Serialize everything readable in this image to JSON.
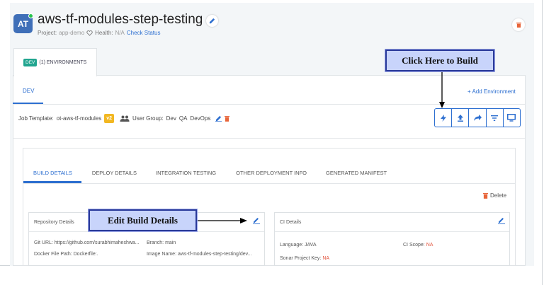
{
  "header": {
    "avatar_initials": "AT",
    "title": "aws-tf-modules-step-testing",
    "project_label": "Project:",
    "project_value": "app-demo",
    "health_label": "Health:",
    "health_value": "N/A",
    "check_status_link": "Check Status"
  },
  "environments": {
    "badge": "DEV",
    "tab_label": "(1) ENVIRONMENTS",
    "active_env_tab": "DEV",
    "add_env_label": "+ Add Environment"
  },
  "job_row": {
    "template_label": "Job Template:",
    "template_value": "ot-aws-tf-modules",
    "version_badge": "v2",
    "user_group_label": "User Group:",
    "groups": [
      "Dev",
      "QA",
      "DevOps"
    ]
  },
  "toolbar": {
    "icons": [
      "bolt-icon",
      "upload-icon",
      "share-icon",
      "filter-icon",
      "monitor-icon"
    ]
  },
  "details_tabs": [
    {
      "label": "BUILD DETAILS",
      "active": true
    },
    {
      "label": "DEPLOY DETAILS",
      "active": false
    },
    {
      "label": "INTEGRATION TESTING",
      "active": false
    },
    {
      "label": "OTHER DEPLOYMENT INFO",
      "active": false
    },
    {
      "label": "GENERATED MANIFEST",
      "active": false
    }
  ],
  "delete_label": "Delete",
  "repo_box": {
    "title": "Repository Details",
    "git_url": "Git URL: https://github.com/surabhimaheshwa...",
    "branch": "Branch: main",
    "docker_file": "Docker File Path: Dockerfile:.",
    "image_name": "Image Name: aws-tf-modules-step-testing/dev..."
  },
  "ci_box": {
    "title": "CI Details",
    "language": "Language: JAVA",
    "ci_scope_label": "CI Scope:",
    "ci_scope_value": "NA",
    "sonar_label": "Sonar Project Key:",
    "sonar_value": "NA"
  },
  "annotations": {
    "build_callout": "Click Here to Build",
    "edit_callout": "Edit Build Details"
  },
  "colors": {
    "accent": "#2d6fd0",
    "env_badge": "#21a58f",
    "version_badge": "#f2b722",
    "danger": "#e2533c",
    "callout_fill": "#c8d4fb",
    "callout_border": "#2a3a9a"
  }
}
